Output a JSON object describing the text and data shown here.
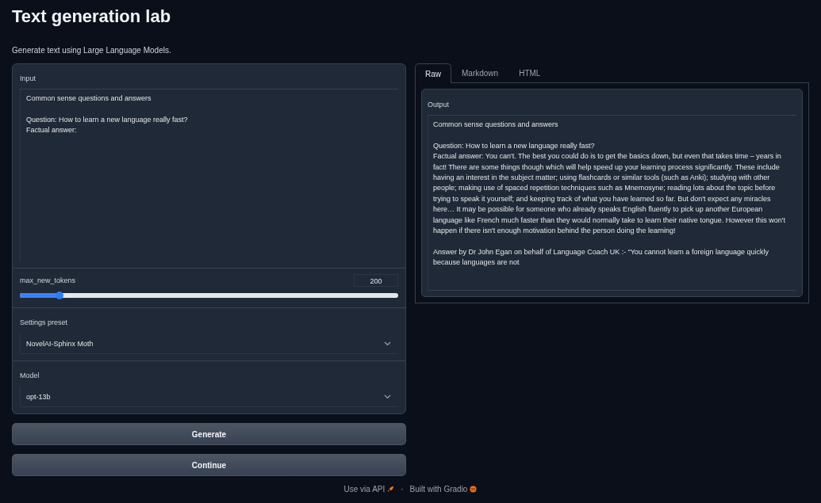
{
  "title": "Text generation lab",
  "subtitle": "Generate text using Large Language Models.",
  "input": {
    "label": "Input",
    "value": "Common sense questions and answers\n\nQuestion: How to learn a new language really fast?\nFactual answer:"
  },
  "slider": {
    "label": "max_new_tokens",
    "reading": "200",
    "level": 0.105
  },
  "dropdowns": [
    {
      "label": "Settings preset",
      "value": "NovelAI-Sphinx Moth"
    },
    {
      "label": "Model",
      "value": "opt-13b"
    }
  ],
  "buttons": [
    "Generate",
    "Continue"
  ],
  "tabs": [
    {
      "label": "Raw",
      "selected": true
    },
    {
      "label": "Markdown",
      "selected": false
    },
    {
      "label": "HTML",
      "selected": false
    }
  ],
  "output": {
    "label": "Output",
    "value": "Common sense questions and answers\n\nQuestion: How to learn a new language really fast?\nFactual answer: You can't. The best you could do is to get the basics down, but even that takes time – years in fact! There are some things though which will help speed up your learning process significantly. These include having an interest in the subject matter; using flashcards or similar tools (such as Anki); studying with other people; making use of spaced repetition techniques such as Mnemosyne; reading lots about the topic before trying to speak it yourself; and keeping track of what you have learned so far. But don't expect any miracles here… It may be possible for someone who already speaks English fluently to pick up another European language like French much faster than they would normally take to learn their native tongue. However this won't happen if there isn't enough motivation behind the person doing the learning!\n\nAnswer by Dr John Egan on behalf of Language Coach UK :- “You cannot learn a foreign language quickly because languages are not"
  },
  "footer": {
    "api_link": "Use via API",
    "separator": "·",
    "built_with": "Built with Gradio"
  }
}
